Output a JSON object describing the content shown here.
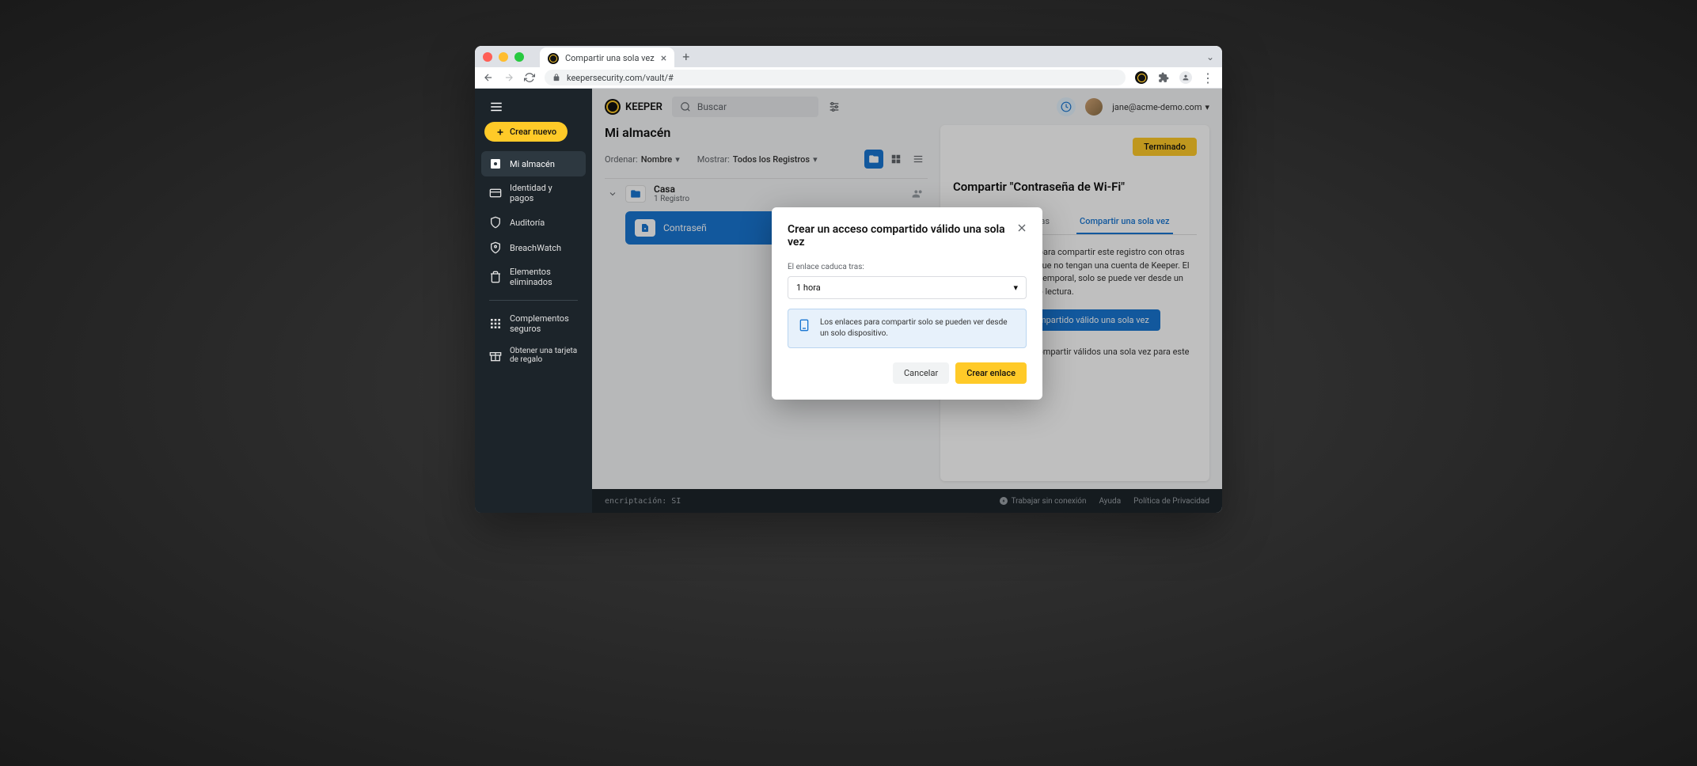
{
  "browser": {
    "tab_title": "Compartir una sola vez",
    "url": "keepersecurity.com/vault/#"
  },
  "sidebar": {
    "create_label": "Crear nuevo",
    "items": [
      {
        "label": "Mi almacén"
      },
      {
        "label": "Identidad y pagos"
      },
      {
        "label": "Auditoría"
      },
      {
        "label": "BreachWatch"
      },
      {
        "label": "Elementos eliminados"
      }
    ],
    "addons_label": "Complementos seguros",
    "referral_label": "Obtener una tarjeta de regalo"
  },
  "header": {
    "logo_text": "KEEPER",
    "search_placeholder": "Buscar",
    "user_email": "jane@acme-demo.com"
  },
  "main": {
    "page_title": "Mi almacén",
    "sort_label": "Ordenar:",
    "sort_value": "Nombre",
    "show_label": "Mostrar:",
    "show_value": "Todos los Registros",
    "folder": {
      "name": "Casa",
      "count": "1 Registro"
    },
    "record": {
      "name": "Contraseñ"
    }
  },
  "detail": {
    "done_label": "Terminado",
    "title": "Compartir \"Contraseña de Wi-Fi\"",
    "tab_people": "Agregar Personas",
    "tab_onetime": "Compartir una sola vez",
    "description": "Cree enlaces seguros para compartir este registro con otras personas, incluso aunque no tengan una cuenta de Keeper. El acceso tiene un límite temporal, solo se puede ver desde un dispositivo y es de solo lectura.",
    "create_btn": "Crear un acceso compartido válido una sola vez",
    "no_links": "No hay enlaces para compartir válidos una sola vez para este registro."
  },
  "footer": {
    "encryption": "encriptación: SI",
    "offline": "Trabajar sin conexión",
    "help": "Ayuda",
    "privacy": "Política de Privacidad"
  },
  "modal": {
    "title": "Crear un acceso compartido válido una sola vez",
    "expiry_label": "El enlace caduca tras:",
    "expiry_value": "1 hora",
    "info_text": "Los enlaces para compartir solo se pueden ver desde un solo dispositivo.",
    "cancel_label": "Cancelar",
    "submit_label": "Crear enlace"
  }
}
